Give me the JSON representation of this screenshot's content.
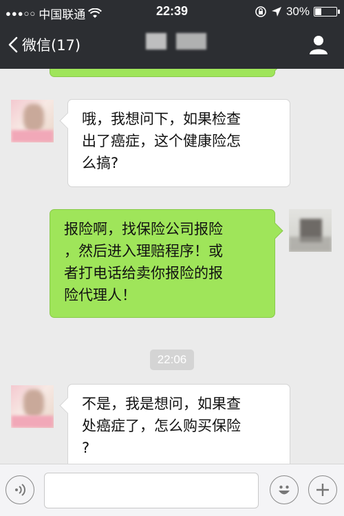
{
  "status_bar": {
    "signal_dots": "●●●○○",
    "carrier": "中国联通",
    "time": "22:39",
    "battery_text": "30%",
    "battery_level": 0.3
  },
  "nav": {
    "back_label": "微信(17)",
    "back_icon": "chevron-left-icon",
    "profile_icon": "person-icon"
  },
  "messages": [
    {
      "side": "in",
      "avatar": "user1",
      "text": "哦，我想问下，如果检查出了癌症，这个健康险怎么搞?"
    },
    {
      "side": "out",
      "avatar": "user2",
      "text": "报险啊，找保险公司报险，然后进入理赔程序！或者打电话给卖你报险的报险代理人！"
    },
    {
      "side": "in",
      "avatar": "user1",
      "text": "不是，我是想问，如果查处癌症了，怎么购买保险?"
    }
  ],
  "message_lines": [
    [
      "哦，我想问下，如果检查",
      "出了癌症，这个健康险怎",
      "么搞?"
    ],
    [
      "报险啊，找保险公司报险",
      "，然后进入理赔程序！或",
      "者打电话给卖你报险的报",
      "险代理人！"
    ],
    [
      "不是，我是想问，如果查",
      "处癌症了，怎么购买保险",
      "?"
    ]
  ],
  "timestamp": "22:06",
  "input": {
    "value": "",
    "voice_icon": "voice-icon",
    "emoji_icon": "emoji-icon",
    "plus_icon": "plus-icon"
  },
  "colors": {
    "header_bg": "#2c2e32",
    "chat_bg": "#ebebeb",
    "outgoing_bubble": "#9fe55a",
    "incoming_bubble": "#ffffff"
  }
}
